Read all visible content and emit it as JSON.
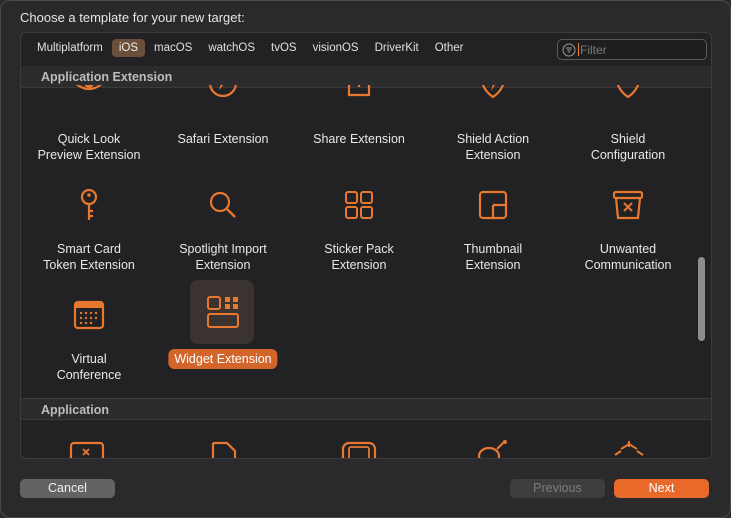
{
  "dialog": {
    "heading": "Choose a template for your new target:"
  },
  "tabs": [
    {
      "label": "Multiplatform",
      "active": false
    },
    {
      "label": "iOS",
      "active": true
    },
    {
      "label": "macOS",
      "active": false
    },
    {
      "label": "watchOS",
      "active": false
    },
    {
      "label": "tvOS",
      "active": false
    },
    {
      "label": "visionOS",
      "active": false
    },
    {
      "label": "DriverKit",
      "active": false
    },
    {
      "label": "Other",
      "active": false
    }
  ],
  "filter": {
    "placeholder": "Filter",
    "value": ""
  },
  "sections": {
    "app_extension": {
      "title": "Application Extension",
      "items": [
        {
          "line1": "Quick Look",
          "line2": "Preview Extension",
          "icon": "eye-icon"
        },
        {
          "line1": "Safari Extension",
          "line2": "",
          "icon": "compass-icon"
        },
        {
          "line1": "Share Extension",
          "line2": "",
          "icon": "share-icon"
        },
        {
          "line1": "Shield Action",
          "line2": "Extension",
          "icon": "shield-bolt-icon"
        },
        {
          "line1": "Shield",
          "line2": "Configuration",
          "icon": "shield-gear-icon"
        },
        {
          "line1": "Smart Card",
          "line2": "Token Extension",
          "icon": "key-icon"
        },
        {
          "line1": "Spotlight Import",
          "line2": "Extension",
          "icon": "magnifier-icon"
        },
        {
          "line1": "Sticker Pack",
          "line2": "Extension",
          "icon": "grid-squares-icon"
        },
        {
          "line1": "Thumbnail",
          "line2": "Extension",
          "icon": "thumbnail-icon"
        },
        {
          "line1": "Unwanted",
          "line2": "Communication",
          "icon": "trash-x-icon"
        },
        {
          "line1": "Virtual",
          "line2": "Conference",
          "icon": "calendar-icon"
        },
        {
          "line1": "Widget Extension",
          "line2": "",
          "icon": "widget-icon",
          "selected": true
        }
      ]
    },
    "application": {
      "title": "Application"
    }
  },
  "buttons": {
    "cancel": "Cancel",
    "previous": "Previous",
    "next": "Next"
  },
  "colors": {
    "accent": "#e8692a",
    "icon_orange": "#e8782f",
    "selection": "#d4652a",
    "tab_active": "#6b4f3a"
  }
}
